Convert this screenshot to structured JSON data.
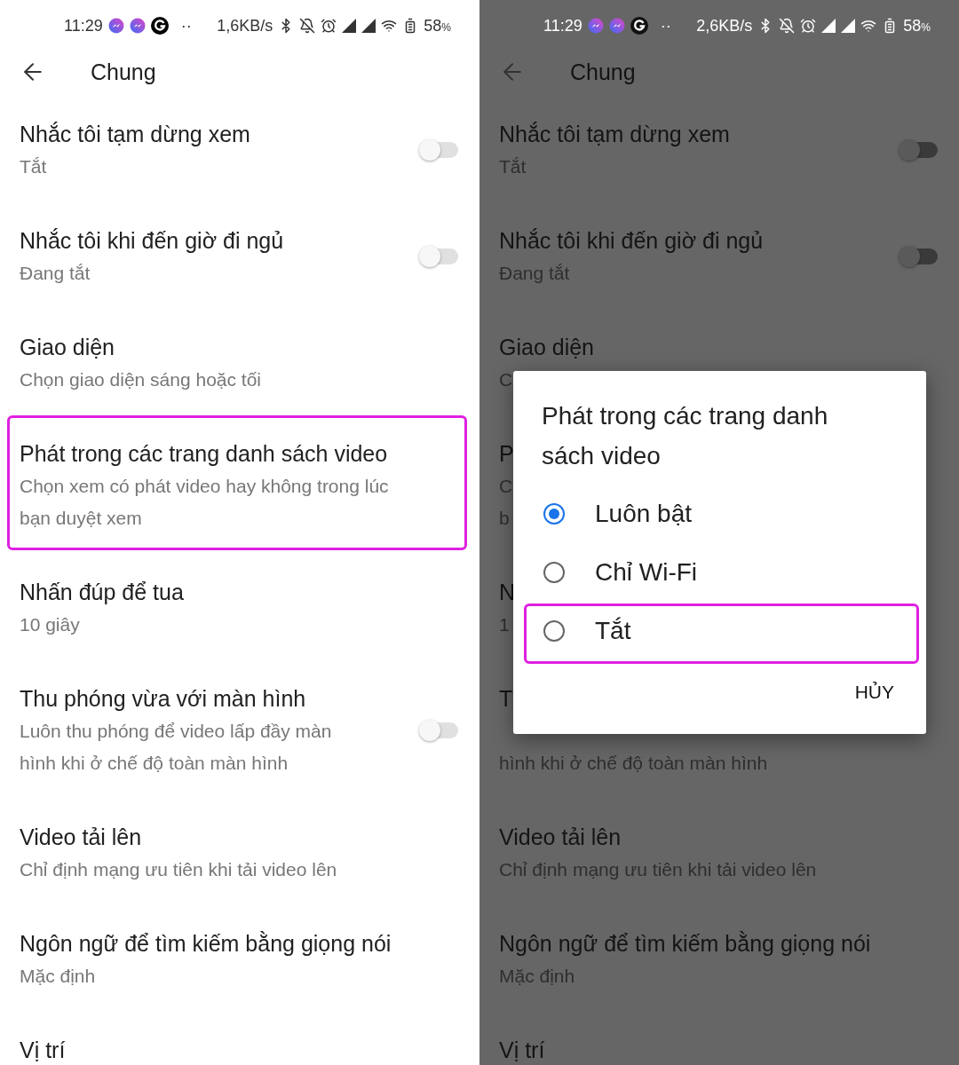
{
  "screens": [
    {
      "dimmed": false,
      "status_bar": {
        "time": "11:29",
        "dots": "··",
        "speed": "1,6KB/s",
        "battery": "58",
        "battery_unit": "%"
      },
      "header": {
        "title": "Chung"
      },
      "items": [
        {
          "title": "Nhắc tôi tạm dừng xem",
          "subtitle_lines": [
            "Tắt"
          ],
          "toggle": {
            "on": false
          },
          "highlighted": false
        },
        {
          "title": "Nhắc tôi khi đến giờ đi ngủ",
          "subtitle_lines": [
            "Đang tắt"
          ],
          "toggle": {
            "on": false
          },
          "highlighted": false
        },
        {
          "title": "Giao diện",
          "subtitle_lines": [
            "Chọn giao diện sáng hoặc tối"
          ],
          "highlighted": false
        },
        {
          "title": "Phát trong các trang danh sách video",
          "subtitle_lines": [
            "Chọn xem có phát video hay không trong lúc",
            "bạn duyệt xem"
          ],
          "highlighted": true
        },
        {
          "title": "Nhấn đúp để tua",
          "subtitle_lines": [
            "10 giây"
          ],
          "highlighted": false
        },
        {
          "title": "Thu phóng vừa với màn hình",
          "subtitle_lines": [
            "Luôn thu phóng để video lấp đầy màn",
            "hình khi ở chế độ toàn màn hình"
          ],
          "toggle": {
            "on": false
          },
          "highlighted": false
        },
        {
          "title": "Video tải lên",
          "subtitle_lines": [
            "Chỉ định mạng ưu tiên khi tải video lên"
          ],
          "highlighted": false
        },
        {
          "title": "Ngôn ngữ để tìm kiếm bằng giọng nói",
          "subtitle_lines": [
            "Mặc định"
          ],
          "highlighted": false
        },
        {
          "title": "Vị trí",
          "highlighted": false
        }
      ]
    },
    {
      "dimmed": true,
      "status_bar": {
        "time": "11:29",
        "dots": "··",
        "speed": "2,6KB/s",
        "battery": "58",
        "battery_unit": "%"
      },
      "header": {
        "title": "Chung"
      },
      "items": [
        {
          "title": "Nhắc tôi tạm dừng xem",
          "subtitle_lines": [
            "Tắt"
          ],
          "toggle": {
            "on": false
          },
          "highlighted": false
        },
        {
          "title": "Nhắc tôi khi đến giờ đi ngủ",
          "subtitle_lines": [
            "Đang tắt"
          ],
          "toggle": {
            "on": false
          },
          "highlighted": false
        },
        {
          "title": "Giao diện",
          "subtitle_lines": [
            "C"
          ],
          "highlighted": false
        },
        {
          "title": "P",
          "subtitle_lines": [
            "C",
            "b"
          ],
          "highlighted": false
        },
        {
          "title": "N",
          "subtitle_lines": [
            "1"
          ],
          "highlighted": false
        },
        {
          "title": "T",
          "subtitle_lines": [
            "hình khi ở chế độ toàn màn hình"
          ],
          "covered": true,
          "highlighted": false
        },
        {
          "title": "Video tải lên",
          "subtitle_lines": [
            "Chỉ định mạng ưu tiên khi tải video lên"
          ],
          "highlighted": false
        },
        {
          "title": "Ngôn ngữ để tìm kiếm bằng giọng nói",
          "subtitle_lines": [
            "Mặc định"
          ],
          "highlighted": false
        },
        {
          "title": "Vị trí",
          "highlighted": false
        }
      ],
      "dialog": {
        "title": "Phát trong các trang danh sách video",
        "options": [
          {
            "label": "Luôn bật",
            "selected": true,
            "highlighted": false
          },
          {
            "label": "Chỉ Wi-Fi",
            "selected": false,
            "highlighted": false
          },
          {
            "label": "Tắt",
            "selected": false,
            "highlighted": true
          }
        ],
        "cancel": "HỦY"
      }
    }
  ]
}
